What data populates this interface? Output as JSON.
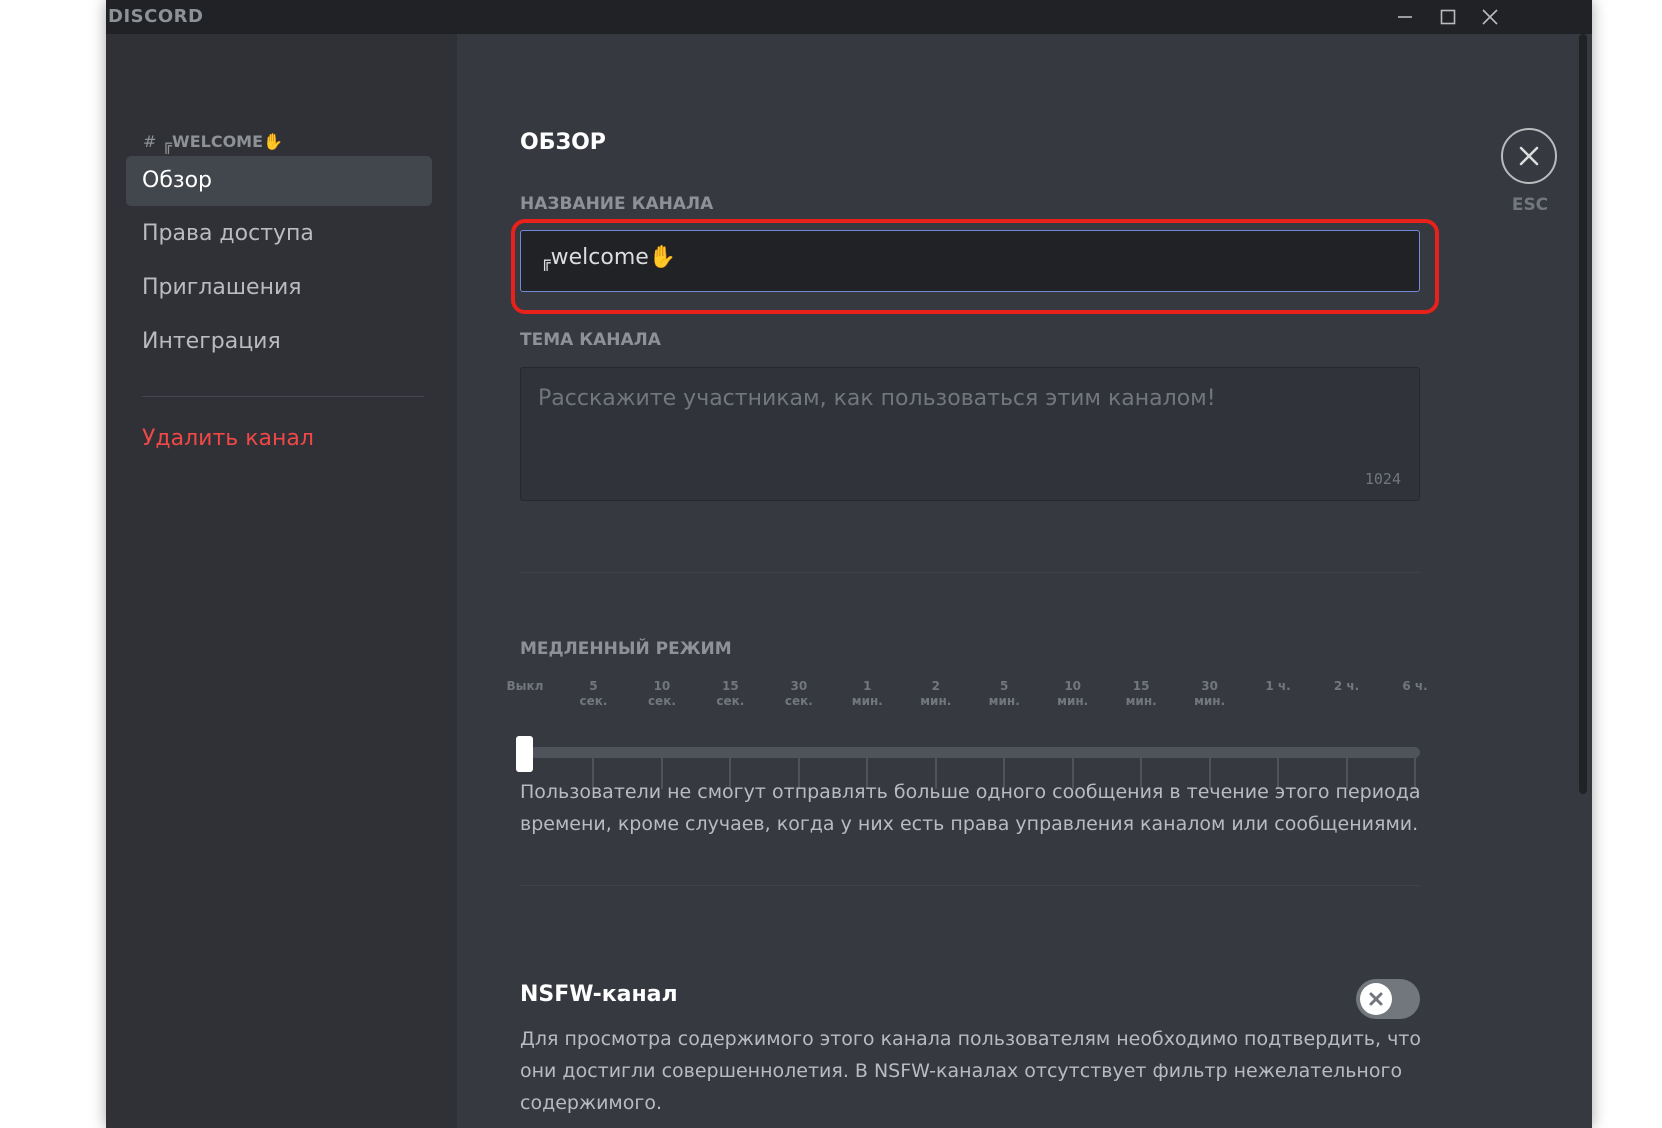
{
  "app": {
    "brand": "DISCORD"
  },
  "sidebar": {
    "channel_header": "WELCOME",
    "channel_prefix_glyph": "╔",
    "hash": "#",
    "items": [
      {
        "label": "Обзор",
        "active": true
      },
      {
        "label": "Права доступа",
        "active": false
      },
      {
        "label": "Приглашения",
        "active": false
      },
      {
        "label": "Интеграция",
        "active": false
      }
    ],
    "delete_label": "Удалить канал"
  },
  "main": {
    "title": "ОБЗОР",
    "channel_name_label": "НАЗВАНИЕ КАНАЛА",
    "channel_name_glyph": "╔",
    "channel_name_value": "welcome",
    "topic_label": "ТЕМА КАНАЛА",
    "topic_placeholder": "Расскажите участникам, как пользоваться этим каналом!",
    "topic_counter": "1024",
    "slowmode": {
      "label": "МЕДЛЕННЫЙ РЕЖИМ",
      "selected_index": 0,
      "ticks": [
        {
          "line1": "Выкл",
          "line2": ""
        },
        {
          "line1": "5",
          "line2": "сек."
        },
        {
          "line1": "10",
          "line2": "сек."
        },
        {
          "line1": "15",
          "line2": "сек."
        },
        {
          "line1": "30",
          "line2": "сек."
        },
        {
          "line1": "1",
          "line2": "мин."
        },
        {
          "line1": "2",
          "line2": "мин."
        },
        {
          "line1": "5",
          "line2": "мин."
        },
        {
          "line1": "10",
          "line2": "мин."
        },
        {
          "line1": "15",
          "line2": "мин."
        },
        {
          "line1": "30",
          "line2": "мин."
        },
        {
          "line1": "1 ч.",
          "line2": ""
        },
        {
          "line1": "2 ч.",
          "line2": ""
        },
        {
          "line1": "6 ч.",
          "line2": ""
        }
      ],
      "help_line1": "Пользователи не смогут отправлять больше одного сообщения в течение этого периода",
      "help_line2": "времени, кроме случаев, когда у них есть права управления каналом или сообщениями."
    },
    "nsfw": {
      "title": "NSFW-канал",
      "enabled": false,
      "help_line1": "Для просмотра содержимого этого канала пользователям необходимо подтвердить, что",
      "help_line2": "они достигли совершеннолетия. В NSFW-каналах отсутствует фильтр нежелательного",
      "help_line3": "содержимого."
    },
    "close_label": "ESC"
  },
  "colors": {
    "accent": "#7289da",
    "danger": "#f04747",
    "highlight": "#e8211b"
  }
}
